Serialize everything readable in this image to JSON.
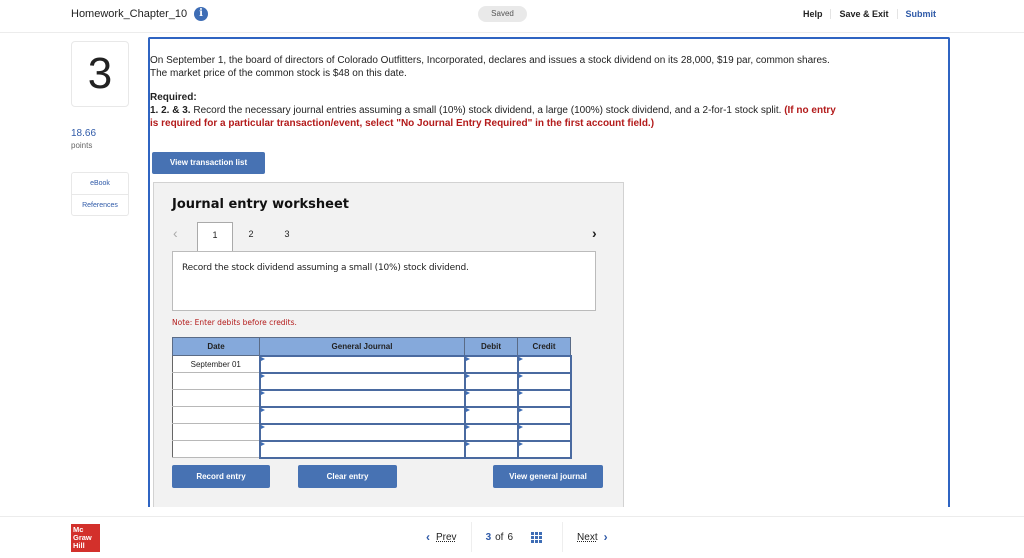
{
  "header": {
    "title": "Homework_Chapter_10",
    "info_icon": "i",
    "saved_label": "Saved",
    "links": {
      "help": "Help",
      "save_exit": "Save & Exit",
      "submit": "Submit"
    }
  },
  "sidebar": {
    "question_number": "3",
    "points_value": "18.66",
    "points_label": "points",
    "links": [
      "eBook",
      "References"
    ]
  },
  "question": {
    "text": "On September 1, the board of directors of Colorado Outfitters, Incorporated, declares and issues a stock dividend on its 28,000, $19 par, common shares. The market price of the common stock is $48 on this date.",
    "required_title": "Required:",
    "required_prefix": "1. 2. & 3.",
    "required_text": " Record the necessary journal entries assuming a small (10%) stock dividend, a large (100%) stock dividend, and a 2-for-1 stock split. ",
    "required_note": "(If no entry is required for a particular transaction/event, select \"No Journal Entry Required\" in the first account field.)"
  },
  "view_transaction_list_label": "View transaction list",
  "worksheet": {
    "title": "Journal entry worksheet",
    "prev_icon": "‹",
    "next_icon": "›",
    "tabs": [
      "1",
      "2",
      "3"
    ],
    "active_tab": "1",
    "description": "Record the stock dividend assuming a small (10%) stock dividend.",
    "note": "Note: Enter debits before credits.",
    "columns": {
      "date": "Date",
      "general_journal": "General Journal",
      "debit": "Debit",
      "credit": "Credit"
    },
    "rows": [
      {
        "date": "September 01",
        "account": "",
        "debit": "",
        "credit": ""
      },
      {
        "date": "",
        "account": "",
        "debit": "",
        "credit": ""
      },
      {
        "date": "",
        "account": "",
        "debit": "",
        "credit": ""
      },
      {
        "date": "",
        "account": "",
        "debit": "",
        "credit": ""
      },
      {
        "date": "",
        "account": "",
        "debit": "",
        "credit": ""
      },
      {
        "date": "",
        "account": "",
        "debit": "",
        "credit": ""
      }
    ],
    "buttons": {
      "record": "Record entry",
      "clear": "Clear entry",
      "view_gj": "View general journal"
    }
  },
  "footer": {
    "logo": "Mc Graw Hill",
    "prev_label": "Prev",
    "current_page": "3",
    "of_label": "of",
    "total_pages": "6",
    "next_label": "Next"
  },
  "colors": {
    "accent": "#4772b3",
    "link": "#2f5aa8",
    "warning": "#b31b1b",
    "header_cell": "#85a9db",
    "logo": "#d3302b"
  }
}
